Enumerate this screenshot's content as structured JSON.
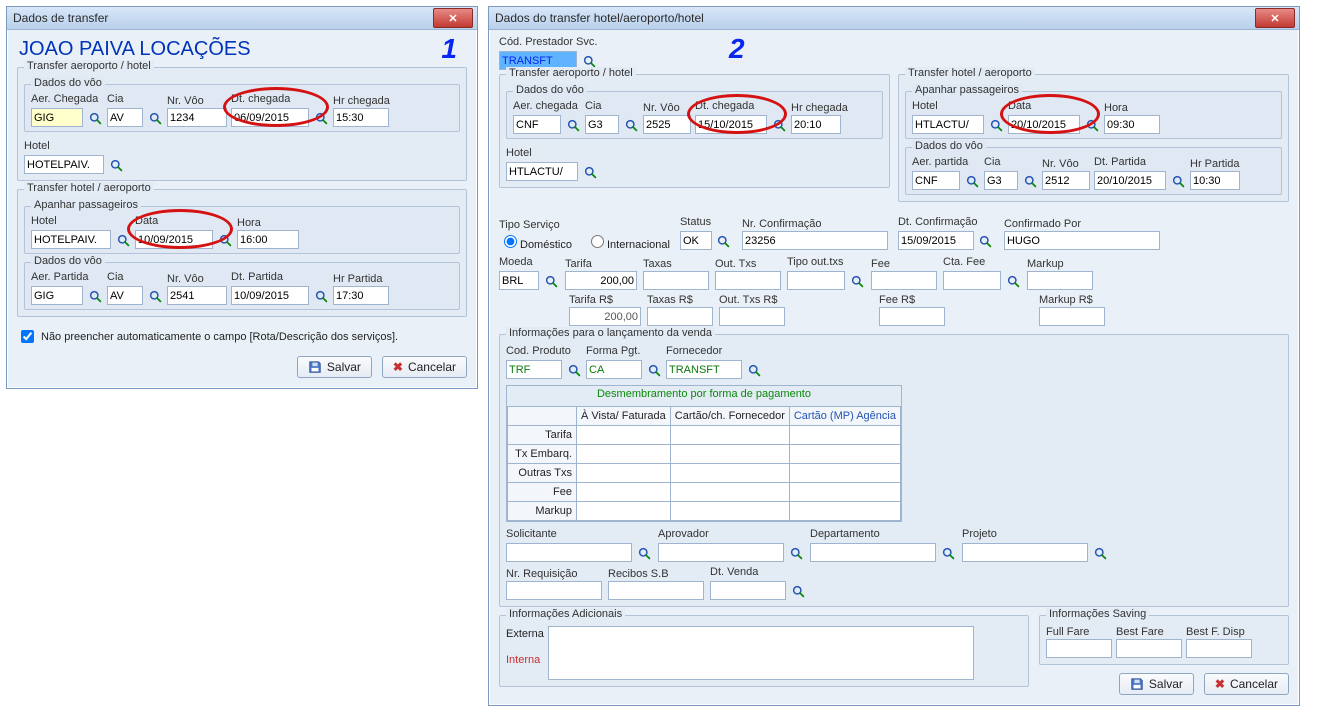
{
  "window1": {
    "title": "Dados de transfer",
    "annotation": "1",
    "heading": "JOAO PAIVA LOCAÇÕES",
    "grp_ap_hotel": {
      "title": "Transfer aeroporto / hotel",
      "voo": {
        "title": "Dados do vôo",
        "aer_chegada_lbl": "Aer. Chegada",
        "aer_chegada": "GIG",
        "cia_lbl": "Cia",
        "cia": "AV",
        "nrvoo_lbl": "Nr. Vôo",
        "nrvoo": "1234",
        "dtcheg_lbl": "Dt. chegada",
        "dtcheg": "06/09/2015",
        "hrcheg_lbl": "Hr chegada",
        "hrcheg": "15:30"
      },
      "hotel_lbl": "Hotel",
      "hotel": "HOTELPAIV."
    },
    "grp_hotel_ap": {
      "title": "Transfer hotel / aeroporto",
      "apanhar": {
        "title": "Apanhar passageiros",
        "hotel_lbl": "Hotel",
        "hotel": "HOTELPAIV.",
        "data_lbl": "Data",
        "data": "10/09/2015",
        "hora_lbl": "Hora",
        "hora": "16:00"
      },
      "voo": {
        "title": "Dados do vôo",
        "aer_part_lbl": "Aer. Partida",
        "aer_part": "GIG",
        "cia_lbl": "Cia",
        "cia": "AV",
        "nrvoo_lbl": "Nr. Vôo",
        "nrvoo": "2541",
        "dtpart_lbl": "Dt. Partida",
        "dtpart": "10/09/2015",
        "hrpart_lbl": "Hr Partida",
        "hrpart": "17:30"
      }
    },
    "chk_auto_lbl": "Não preencher automaticamente o campo [Rota/Descrição dos serviços].",
    "btn_save": "Salvar",
    "btn_cancel": "Cancelar"
  },
  "window2": {
    "title": "Dados do transfer hotel/aeroporto/hotel",
    "annotation": "2",
    "prestador_lbl": "Cód. Prestador Svc.",
    "prestador": "TRANSFT",
    "grp_ap_hotel": {
      "title": "Transfer aeroporto / hotel",
      "voo": {
        "title": "Dados do vôo",
        "aer_chegada_lbl": "Aer. chegada",
        "aer_chegada": "CNF",
        "cia_lbl": "Cia",
        "cia": "G3",
        "nrvoo_lbl": "Nr. Vôo",
        "nrvoo": "2525",
        "dtcheg_lbl": "Dt. chegada",
        "dtcheg": "15/10/2015",
        "hrcheg_lbl": "Hr chegada",
        "hrcheg": "20:10"
      },
      "hotel_lbl": "Hotel",
      "hotel": "HTLACTU/"
    },
    "grp_hotel_ap": {
      "title": "Transfer hotel / aeroporto",
      "apanhar": {
        "title": "Apanhar passageiros",
        "hotel_lbl": "Hotel",
        "hotel": "HTLACTU/",
        "data_lbl": "Data",
        "data": "20/10/2015",
        "hora_lbl": "Hora",
        "hora": "09:30"
      },
      "voo": {
        "title": "Dados do vôo",
        "aer_part_lbl": "Aer. partida",
        "aer_part": "CNF",
        "cia_lbl": "Cia",
        "cia": "G3",
        "nrvoo_lbl": "Nr. Vôo",
        "nrvoo": "2512",
        "dtpart_lbl": "Dt. Partida",
        "dtpart": "20/10/2015",
        "hrpart_lbl": "Hr Partida",
        "hrpart": "10:30"
      }
    },
    "svc": {
      "tipo_lbl": "Tipo Serviço",
      "opt_dom": "Doméstico",
      "opt_int": "Internacional",
      "status_lbl": "Status",
      "status": "OK",
      "nrconf_lbl": "Nr. Confirmação",
      "nrconf": "23256",
      "dtconf_lbl": "Dt. Confirmação",
      "dtconf": "15/09/2015",
      "confpor_lbl": "Confirmado Por",
      "confpor": "HUGO"
    },
    "money": {
      "moeda_lbl": "Moeda",
      "moeda": "BRL",
      "tarifa_lbl": "Tarifa",
      "tarifa": "200,00",
      "taxas_lbl": "Taxas",
      "taxas": "",
      "outtxs_lbl": "Out. Txs",
      "outtxs": "",
      "tipoouttxs_lbl": "Tipo out.txs",
      "tipoouttxs": "",
      "fee_lbl": "Fee",
      "fee": "",
      "ctafee_lbl": "Cta. Fee",
      "ctafee": "",
      "markup_lbl": "Markup",
      "markup": ""
    },
    "money2": {
      "tarifaR_lbl": "Tarifa R$",
      "tarifaR": "200,00",
      "taxasR_lbl": "Taxas R$",
      "taxasR": "",
      "outtxsR_lbl": "Out. Txs R$",
      "outtxsR": "",
      "feeR_lbl": "Fee R$",
      "feeR": "",
      "markupR_lbl": "Markup R$",
      "markupR": ""
    },
    "lanc": {
      "title": "Informações para o lançamento da venda",
      "codprod_lbl": "Cod. Produto",
      "codprod": "TRF",
      "formapg_lbl": "Forma Pgt.",
      "formapg": "CA",
      "fornec_lbl": "Fornecedor",
      "fornec": "TRANSFT"
    },
    "desmemb": {
      "title": "Desmembramento por forma de pagamento",
      "col1": "À Vista/ Faturada",
      "col2": "Cartão/ch. Fornecedor",
      "col3": "Cartão (MP) Agência",
      "r1": "Tarifa",
      "r2": "Tx Embarq.",
      "r3": "Outras Txs",
      "r4": "Fee",
      "r5": "Markup"
    },
    "extras": {
      "solic_lbl": "Solicitante",
      "aprov_lbl": "Aprovador",
      "dept_lbl": "Departamento",
      "proj_lbl": "Projeto",
      "nrreq_lbl": "Nr. Requisição",
      "recibos_lbl": "Recibos S.B",
      "dtvenda_lbl": "Dt. Venda"
    },
    "info_adic": {
      "title": "Informações Adicionais",
      "externa_lbl": "Externa",
      "interna_lbl": "Interna"
    },
    "saving": {
      "title": "Informações Saving",
      "fullfare_lbl": "Full Fare",
      "bestfare_lbl": "Best Fare",
      "bestfdisp_lbl": "Best F. Disp"
    },
    "btn_save": "Salvar",
    "btn_cancel": "Cancelar"
  }
}
